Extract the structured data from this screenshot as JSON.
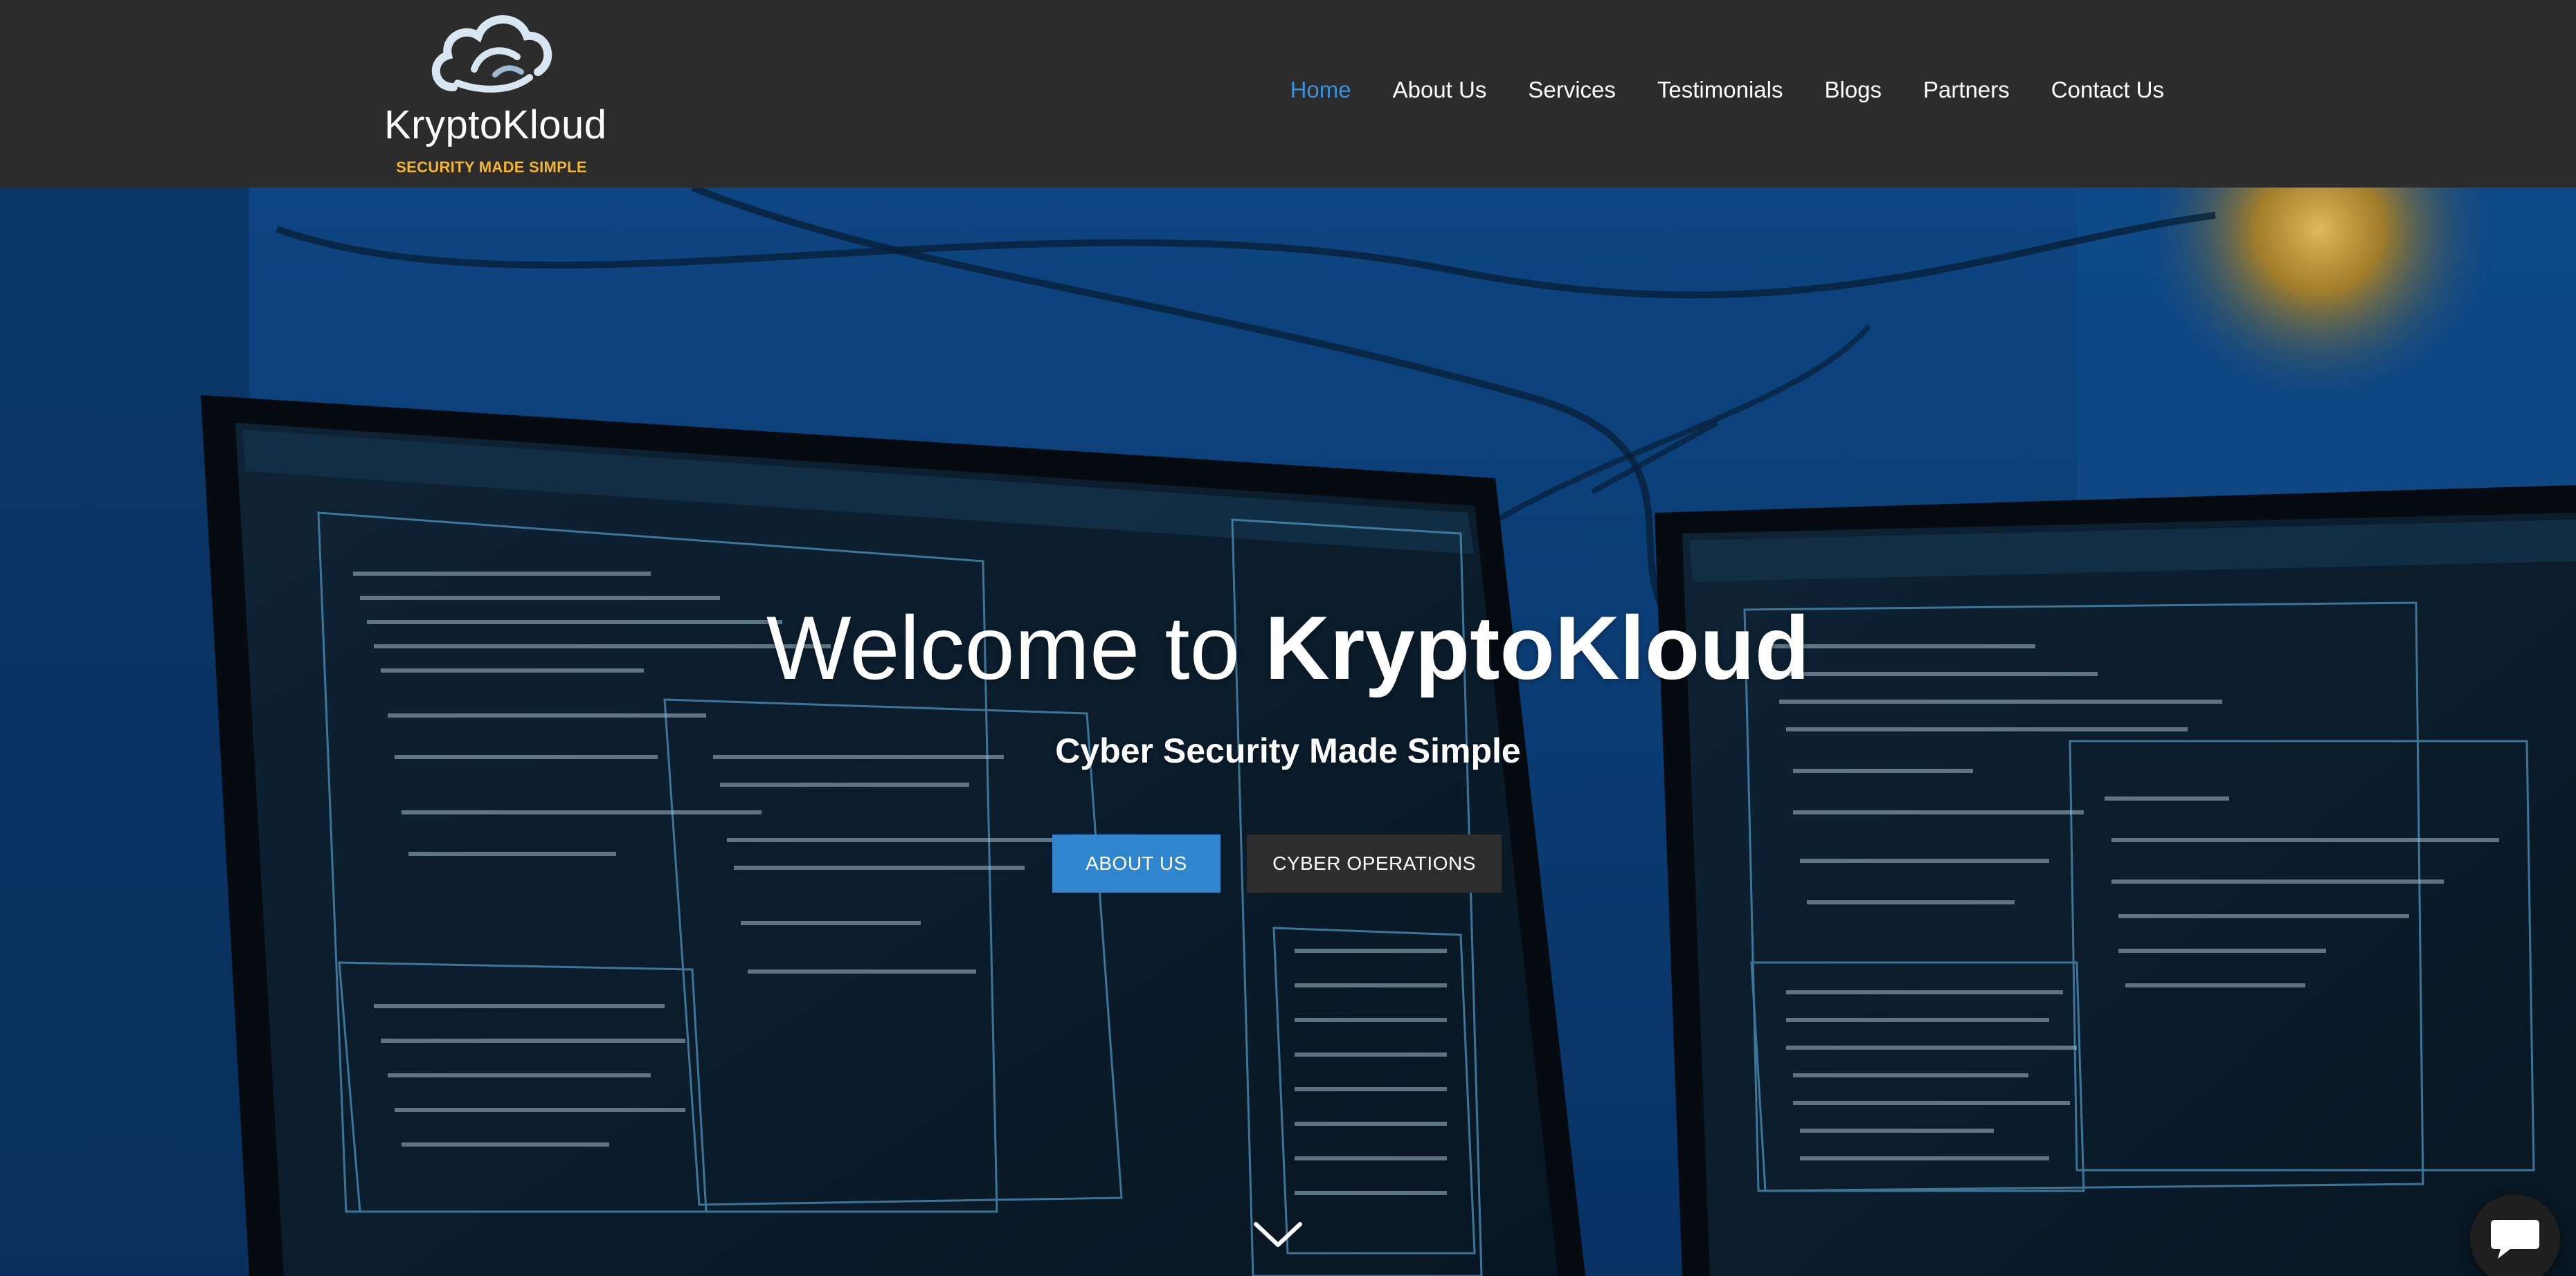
{
  "brand": {
    "name": "KryptoKloud",
    "tagline": "SECURITY MADE SIMPLE",
    "tagline_color": "#f2b632",
    "icon": "cloud-logo-icon"
  },
  "nav": {
    "items": [
      {
        "label": "Home",
        "active": true
      },
      {
        "label": "About Us",
        "active": false
      },
      {
        "label": "Services",
        "active": false
      },
      {
        "label": "Testimonials",
        "active": false
      },
      {
        "label": "Blogs",
        "active": false
      },
      {
        "label": "Partners",
        "active": false
      },
      {
        "label": "Contact Us",
        "active": false
      }
    ],
    "active_color": "#3b8fd8"
  },
  "hero": {
    "title_prefix": "Welcome to ",
    "title_brand": "KryptoKloud",
    "subtitle": "Cyber Security Made Simple",
    "buttons": {
      "about_label": "ABOUT US",
      "cyber_label": "CYBER OPERATIONS"
    },
    "scroll_icon": "chevron-down-icon",
    "background_icon": "monitors-code-screens-image"
  },
  "chat": {
    "icon": "chat-bubble-icon"
  },
  "colors": {
    "header_bg": "#2c2c2c",
    "hero_bg": "#0b3f7a",
    "primary_button": "#2f86cf",
    "secondary_button": "#2d2d2d"
  }
}
